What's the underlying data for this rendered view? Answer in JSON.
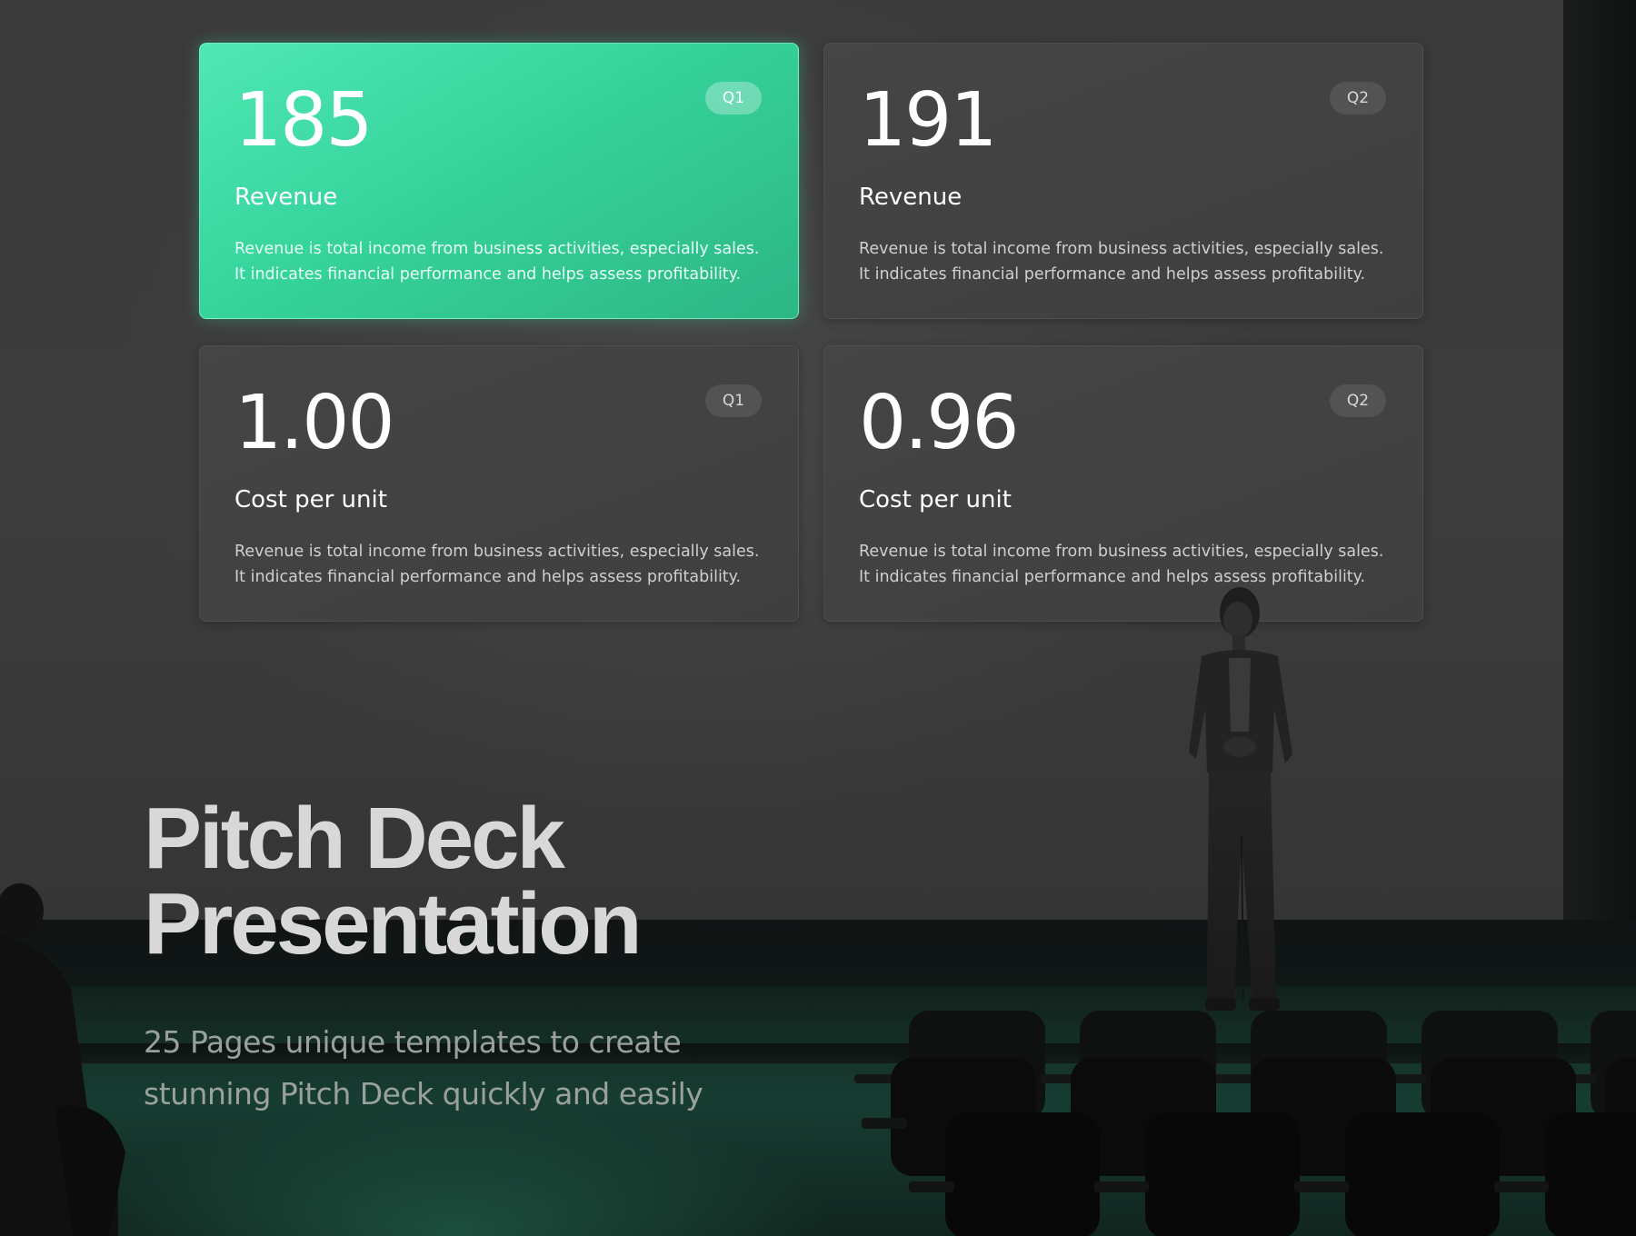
{
  "cards": [
    {
      "value": "185",
      "label": "Revenue",
      "badge": "Q1",
      "desc_line1": "Revenue is total income from business activities, especially sales.",
      "desc_line2": "It indicates financial performance and helps assess profitability.",
      "highlighted": true
    },
    {
      "value": "191",
      "label": "Revenue",
      "badge": "Q2",
      "desc_line1": "Revenue is total income from business activities, especially sales.",
      "desc_line2": "It indicates financial performance and helps assess profitability.",
      "highlighted": false
    },
    {
      "value": "1.00",
      "label": "Cost per unit",
      "badge": "Q1",
      "desc_line1": "Revenue is total income from business activities, especially sales.",
      "desc_line2": "It indicates financial performance and helps assess profitability.",
      "highlighted": false
    },
    {
      "value": "0.96",
      "label": "Cost per unit",
      "badge": "Q2",
      "desc_line1": "Revenue is total income from business activities, especially sales.",
      "desc_line2": "It indicates financial performance and helps assess profitability.",
      "highlighted": false
    }
  ],
  "headline": {
    "line1": "Pitch Deck",
    "line2": "Presentation"
  },
  "subtitle": {
    "line1": "25 Pages unique templates to create",
    "line2": "stunning Pitch Deck quickly and easily"
  },
  "colors": {
    "accent": "#3cd9a2",
    "screen": "#3b3b3b",
    "card": "#434343",
    "floor_glow": "#1f6b54"
  }
}
